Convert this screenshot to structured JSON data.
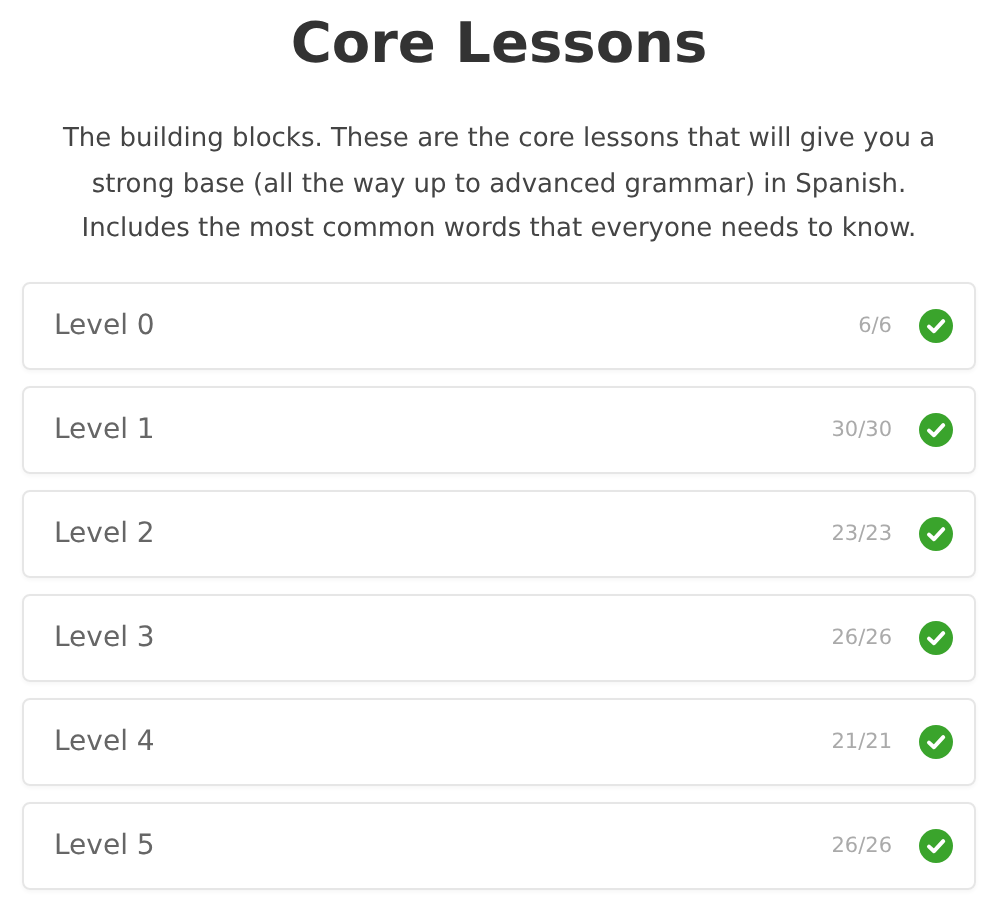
{
  "title": "Core Lessons",
  "description": "The building blocks. These are the core lessons that will give you a strong base (all the way up to advanced grammar) in Spanish. Includes the most common words that everyone needs to know.",
  "levels": [
    {
      "name": "Level 0",
      "progress": "6/6",
      "completed": true
    },
    {
      "name": "Level 1",
      "progress": "30/30",
      "completed": true
    },
    {
      "name": "Level 2",
      "progress": "23/23",
      "completed": true
    },
    {
      "name": "Level 3",
      "progress": "26/26",
      "completed": true
    },
    {
      "name": "Level 4",
      "progress": "21/21",
      "completed": true
    },
    {
      "name": "Level 5",
      "progress": "26/26",
      "completed": true
    }
  ]
}
